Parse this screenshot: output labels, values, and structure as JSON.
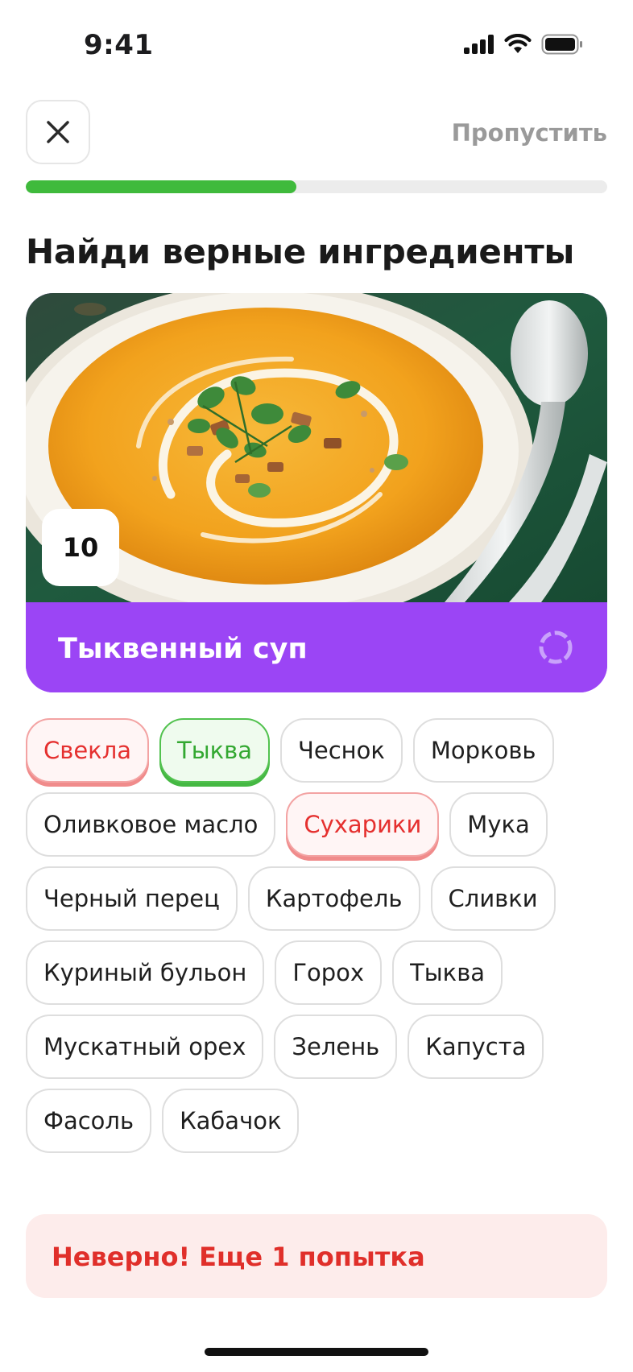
{
  "status_bar": {
    "time": "9:41"
  },
  "header": {
    "skip_label": "Пропустить"
  },
  "progress": {
    "fraction": 0.465,
    "color": "#3fba3c"
  },
  "title": "Найди верные ингредиенты",
  "recipe": {
    "timer": "10",
    "name": "Тыквенный суп",
    "accent": "#9b45f5"
  },
  "ingredients": [
    {
      "label": "Свекла",
      "state": "wrong"
    },
    {
      "label": "Тыква",
      "state": "right"
    },
    {
      "label": "Чеснок",
      "state": "default"
    },
    {
      "label": "Морковь",
      "state": "default"
    },
    {
      "label": "Оливковое масло",
      "state": "default"
    },
    {
      "label": "Сухарики",
      "state": "wrong"
    },
    {
      "label": "Мука",
      "state": "default"
    },
    {
      "label": "Черный перец",
      "state": "default"
    },
    {
      "label": "Картофель",
      "state": "default"
    },
    {
      "label": "Сливки",
      "state": "default"
    },
    {
      "label": "Куриный бульон",
      "state": "default"
    },
    {
      "label": "Горох",
      "state": "default"
    },
    {
      "label": "Тыква",
      "state": "default"
    },
    {
      "label": "Мускатный орех",
      "state": "default"
    },
    {
      "label": "Зелень",
      "state": "default"
    },
    {
      "label": "Капуста",
      "state": "default"
    },
    {
      "label": "Фасоль",
      "state": "default"
    },
    {
      "label": "Кабачок",
      "state": "default"
    }
  ],
  "feedback": {
    "text": "Неверно! Еще 1 попытка",
    "color": "#e02f2a"
  }
}
